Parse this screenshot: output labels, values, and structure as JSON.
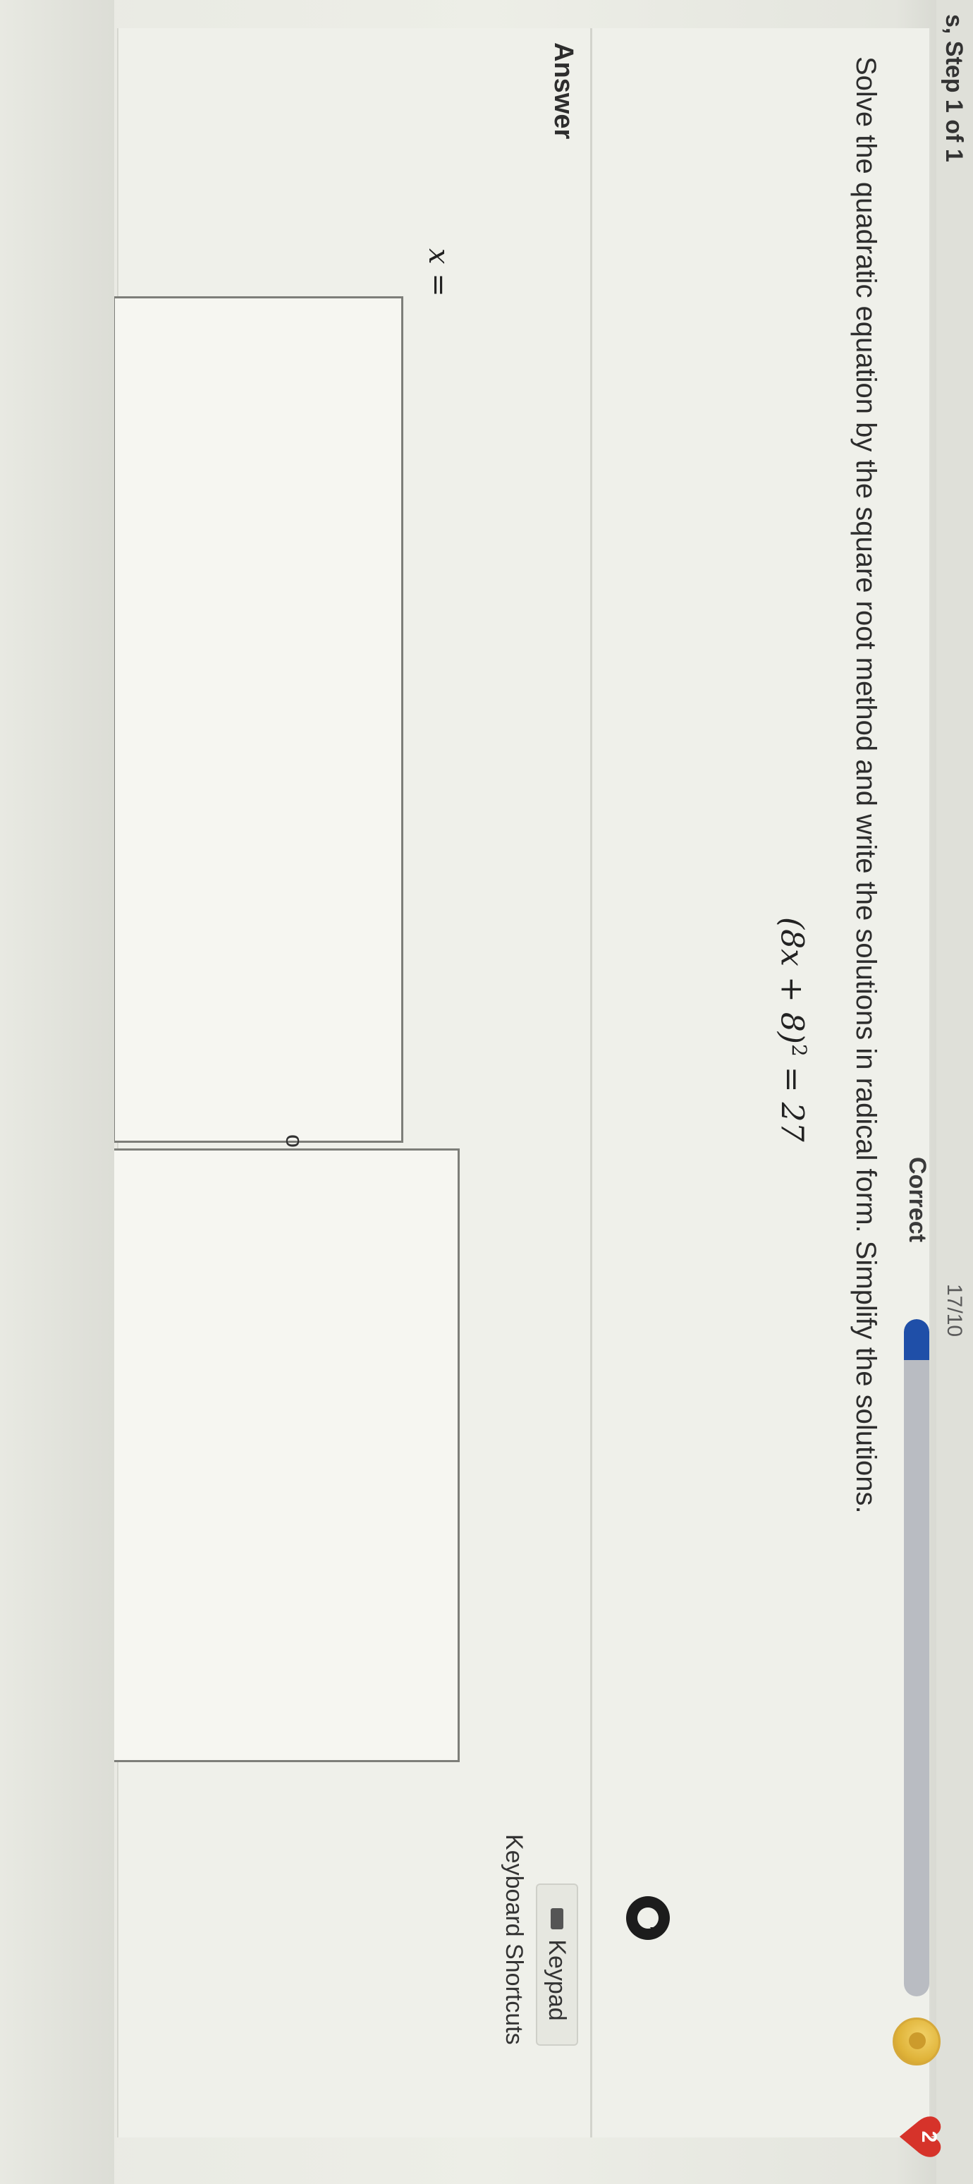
{
  "header": {
    "cut_text": "s, Step 1 of 1",
    "progress_counter": "17/10",
    "status_label": "Correct",
    "progress_fraction": 0.06,
    "progress_color": "#1f4fa8",
    "trophy_icon": "trophy-icon",
    "lives_count": "2",
    "lives_icon": "heart-icon"
  },
  "question": {
    "instruction": "Solve the quadratic equation by the square root method and write the solutions in radical form. Simplify the solutions.",
    "equation_main": "(8x + 8)",
    "equation_exponent": "2",
    "equation_rhs": " = 27",
    "audio_icon": "audio-icon"
  },
  "answer": {
    "heading": "Answer",
    "variable_label": "x =",
    "separator": "or",
    "input_1_value": "",
    "input_2_value": ""
  },
  "tools": {
    "keypad_label": "Keypad",
    "keypad_icon": "keyboard-icon",
    "shortcuts_label": "Keyboard Shortcuts"
  }
}
